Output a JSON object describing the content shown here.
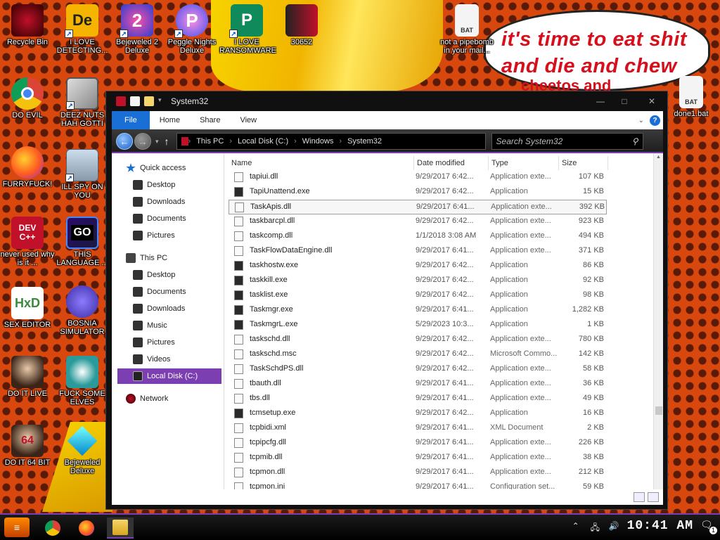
{
  "speech": {
    "line1": "it's time to eat shit",
    "line2": "and die and chew",
    "line3": "cheetos and"
  },
  "desktop_icons": [
    {
      "label": "Recycle Bin"
    },
    {
      "label": "I LOVE DETECTING..."
    },
    {
      "label": "Bejeweled 2 Deluxe"
    },
    {
      "label": "Peggle Nights Deluxe"
    },
    {
      "label": "I LOVE RANSOMWARE"
    },
    {
      "label": "30652"
    },
    {
      "label": "not a pipebomb in your mail..."
    },
    {
      "label": "DO EVIL"
    },
    {
      "label": "DEEZ NUTS HAH GOTTI"
    },
    {
      "label": "FURRYFUCK!"
    },
    {
      "label": "ILL SPY ON YOU"
    },
    {
      "label": "never used why is it ..."
    },
    {
      "label": "THIS LANGUAGE ..."
    },
    {
      "label": "SEX EDITOR"
    },
    {
      "label": "BOSNIA SIMULATOR"
    },
    {
      "label": "DO IT LIVE"
    },
    {
      "label": "FUCK SOME ELVES"
    },
    {
      "label": "DO IT 64 BIT"
    },
    {
      "label": "Bejeweled Deluxe"
    },
    {
      "label": "done1.bat"
    }
  ],
  "icon_texts": {
    "de": "De",
    "dev": "DEV C++",
    "go": "GO",
    "bat": "BAT",
    "hxd": "HxD"
  },
  "window": {
    "title": "System32",
    "buttons": {
      "minimize": "—",
      "maximize": "□",
      "close": "✕"
    },
    "ribbon_tabs": [
      "File",
      "Home",
      "Share",
      "View"
    ],
    "help": "?",
    "breadcrumb": [
      "This PC",
      "Local Disk (C:)",
      "Windows",
      "System32"
    ],
    "search_placeholder": "Search System32",
    "nav": {
      "quick_access": "Quick access",
      "qa_items": [
        "Desktop",
        "Downloads",
        "Documents",
        "Pictures"
      ],
      "this_pc": "This PC",
      "pc_items": [
        "Desktop",
        "Documents",
        "Downloads",
        "Music",
        "Pictures",
        "Videos",
        "Local Disk (C:)"
      ],
      "network": "Network"
    },
    "columns": [
      "Name",
      "Date modified",
      "Type",
      "Size"
    ],
    "files": [
      {
        "name": "tapiui.dll",
        "date": "9/29/2017 6:42...",
        "type": "Application exte...",
        "size": "107 KB",
        "kind": "dll"
      },
      {
        "name": "TapiUnattend.exe",
        "date": "9/29/2017 6:42...",
        "type": "Application",
        "size": "15 KB",
        "kind": "exe"
      },
      {
        "name": "TaskApis.dll",
        "date": "9/29/2017 6:41...",
        "type": "Application exte...",
        "size": "392 KB",
        "kind": "dll",
        "selected": true
      },
      {
        "name": "taskbarcpl.dll",
        "date": "9/29/2017 6:42...",
        "type": "Application exte...",
        "size": "923 KB",
        "kind": "dll"
      },
      {
        "name": "taskcomp.dll",
        "date": "1/1/2018 3:08 AM",
        "type": "Application exte...",
        "size": "494 KB",
        "kind": "dll"
      },
      {
        "name": "TaskFlowDataEngine.dll",
        "date": "9/29/2017 6:41...",
        "type": "Application exte...",
        "size": "371 KB",
        "kind": "dll"
      },
      {
        "name": "taskhostw.exe",
        "date": "9/29/2017 6:42...",
        "type": "Application",
        "size": "86 KB",
        "kind": "exe"
      },
      {
        "name": "taskkill.exe",
        "date": "9/29/2017 6:42...",
        "type": "Application",
        "size": "92 KB",
        "kind": "exe"
      },
      {
        "name": "tasklist.exe",
        "date": "9/29/2017 6:42...",
        "type": "Application",
        "size": "98 KB",
        "kind": "exe"
      },
      {
        "name": "Taskmgr.exe",
        "date": "9/29/2017 6:41...",
        "type": "Application",
        "size": "1,282 KB",
        "kind": "exe"
      },
      {
        "name": "TaskmgrL.exe",
        "date": "5/29/2023 10:3...",
        "type": "Application",
        "size": "1 KB",
        "kind": "exe"
      },
      {
        "name": "taskschd.dll",
        "date": "9/29/2017 6:42...",
        "type": "Application exte...",
        "size": "780 KB",
        "kind": "dll"
      },
      {
        "name": "taskschd.msc",
        "date": "9/29/2017 6:42...",
        "type": "Microsoft Commo...",
        "size": "142 KB",
        "kind": "msc"
      },
      {
        "name": "TaskSchdPS.dll",
        "date": "9/29/2017 6:42...",
        "type": "Application exte...",
        "size": "58 KB",
        "kind": "dll"
      },
      {
        "name": "tbauth.dll",
        "date": "9/29/2017 6:41...",
        "type": "Application exte...",
        "size": "36 KB",
        "kind": "dll"
      },
      {
        "name": "tbs.dll",
        "date": "9/29/2017 6:41...",
        "type": "Application exte...",
        "size": "49 KB",
        "kind": "dll"
      },
      {
        "name": "tcmsetup.exe",
        "date": "9/29/2017 6:42...",
        "type": "Application",
        "size": "16 KB",
        "kind": "exe"
      },
      {
        "name": "tcpbidi.xml",
        "date": "9/29/2017 6:41...",
        "type": "XML Document",
        "size": "2 KB",
        "kind": "xml"
      },
      {
        "name": "tcpipcfg.dll",
        "date": "9/29/2017 6:41...",
        "type": "Application exte...",
        "size": "226 KB",
        "kind": "dll"
      },
      {
        "name": "tcpmib.dll",
        "date": "9/29/2017 6:41...",
        "type": "Application exte...",
        "size": "38 KB",
        "kind": "dll"
      },
      {
        "name": "tcpmon.dll",
        "date": "9/29/2017 6:41...",
        "type": "Application exte...",
        "size": "212 KB",
        "kind": "dll"
      },
      {
        "name": "tcpmon.ini",
        "date": "9/29/2017 6:41...",
        "type": "Configuration set...",
        "size": "59 KB",
        "kind": "ini"
      }
    ]
  },
  "taskbar": {
    "start_label": "≡",
    "clock": "10:41 AM",
    "notification_count": "1",
    "accent": "#7b3fb2"
  }
}
